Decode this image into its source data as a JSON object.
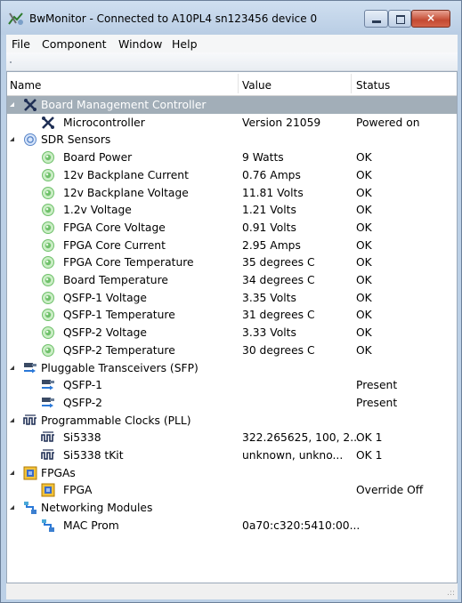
{
  "window": {
    "title": "BwMonitor - Connected to A10PL4 sn123456 device 0",
    "close_glyph": "×"
  },
  "menu": {
    "items": [
      "File",
      "Component",
      "Window",
      "Help"
    ]
  },
  "columns": {
    "name": "Name",
    "value": "Value",
    "status": "Status"
  },
  "groups": [
    {
      "label": "Board Management Controller",
      "icon": "tools-icon",
      "selected": true,
      "children": [
        {
          "name": "Microcontroller",
          "value": "Version 21059",
          "status": "Powered on",
          "icon": "tools-icon"
        }
      ]
    },
    {
      "label": "SDR Sensors",
      "icon": "sensor-icon",
      "children": [
        {
          "name": "Board Power",
          "value": "9 Watts",
          "status": "OK",
          "icon": "sensor-ok-icon"
        },
        {
          "name": "12v Backplane Current",
          "value": "0.76 Amps",
          "status": "OK",
          "icon": "sensor-ok-icon"
        },
        {
          "name": "12v Backplane Voltage",
          "value": "11.81 Volts",
          "status": "OK",
          "icon": "sensor-ok-icon"
        },
        {
          "name": "1.2v Voltage",
          "value": "1.21 Volts",
          "status": "OK",
          "icon": "sensor-ok-icon"
        },
        {
          "name": "FPGA Core Voltage",
          "value": "0.91 Volts",
          "status": "OK",
          "icon": "sensor-ok-icon"
        },
        {
          "name": "FPGA Core Current",
          "value": "2.95 Amps",
          "status": "OK",
          "icon": "sensor-ok-icon"
        },
        {
          "name": "FPGA Core Temperature",
          "value": "35 degrees C",
          "status": "OK",
          "icon": "sensor-ok-icon"
        },
        {
          "name": "Board Temperature",
          "value": "34 degrees C",
          "status": "OK",
          "icon": "sensor-ok-icon"
        },
        {
          "name": "QSFP-1 Voltage",
          "value": "3.35 Volts",
          "status": "OK",
          "icon": "sensor-ok-icon"
        },
        {
          "name": "QSFP-1 Temperature",
          "value": "31 degrees C",
          "status": "OK",
          "icon": "sensor-ok-icon"
        },
        {
          "name": "QSFP-2 Voltage",
          "value": "3.33 Volts",
          "status": "OK",
          "icon": "sensor-ok-icon"
        },
        {
          "name": "QSFP-2 Temperature",
          "value": "30 degrees C",
          "status": "OK",
          "icon": "sensor-ok-icon"
        }
      ]
    },
    {
      "label": "Pluggable Transceivers (SFP)",
      "icon": "transceiver-icon",
      "children": [
        {
          "name": "QSFP-1",
          "value": "",
          "status": "Present",
          "icon": "transceiver-icon"
        },
        {
          "name": "QSFP-2",
          "value": "",
          "status": "Present",
          "icon": "transceiver-icon"
        }
      ]
    },
    {
      "label": "Programmable Clocks (PLL)",
      "icon": "clock-icon",
      "children": [
        {
          "name": "Si5338",
          "value": "322.265625, 100, 2...",
          "status": "OK 1",
          "icon": "clock-icon"
        },
        {
          "name": "Si5338 tKit",
          "value": "unknown, unkno...",
          "status": "OK 1",
          "icon": "clock-icon"
        }
      ]
    },
    {
      "label": "FPGAs",
      "icon": "chip-icon",
      "children": [
        {
          "name": "FPGA",
          "value": "",
          "status": "Override Off",
          "icon": "chip-icon"
        }
      ]
    },
    {
      "label": "Networking Modules",
      "icon": "network-icon",
      "children": [
        {
          "name": "MAC Prom",
          "value": "0a70:c320:5410:00...",
          "status": "",
          "icon": "network-icon"
        }
      ]
    }
  ],
  "colors": {
    "selected_row": "#a2aeb8",
    "title_gradient_top": "#cfdff0",
    "close_button": "#c44a32",
    "sensor_green": "#6fc06a"
  },
  "statusbar": {
    "grip": ".::"
  }
}
